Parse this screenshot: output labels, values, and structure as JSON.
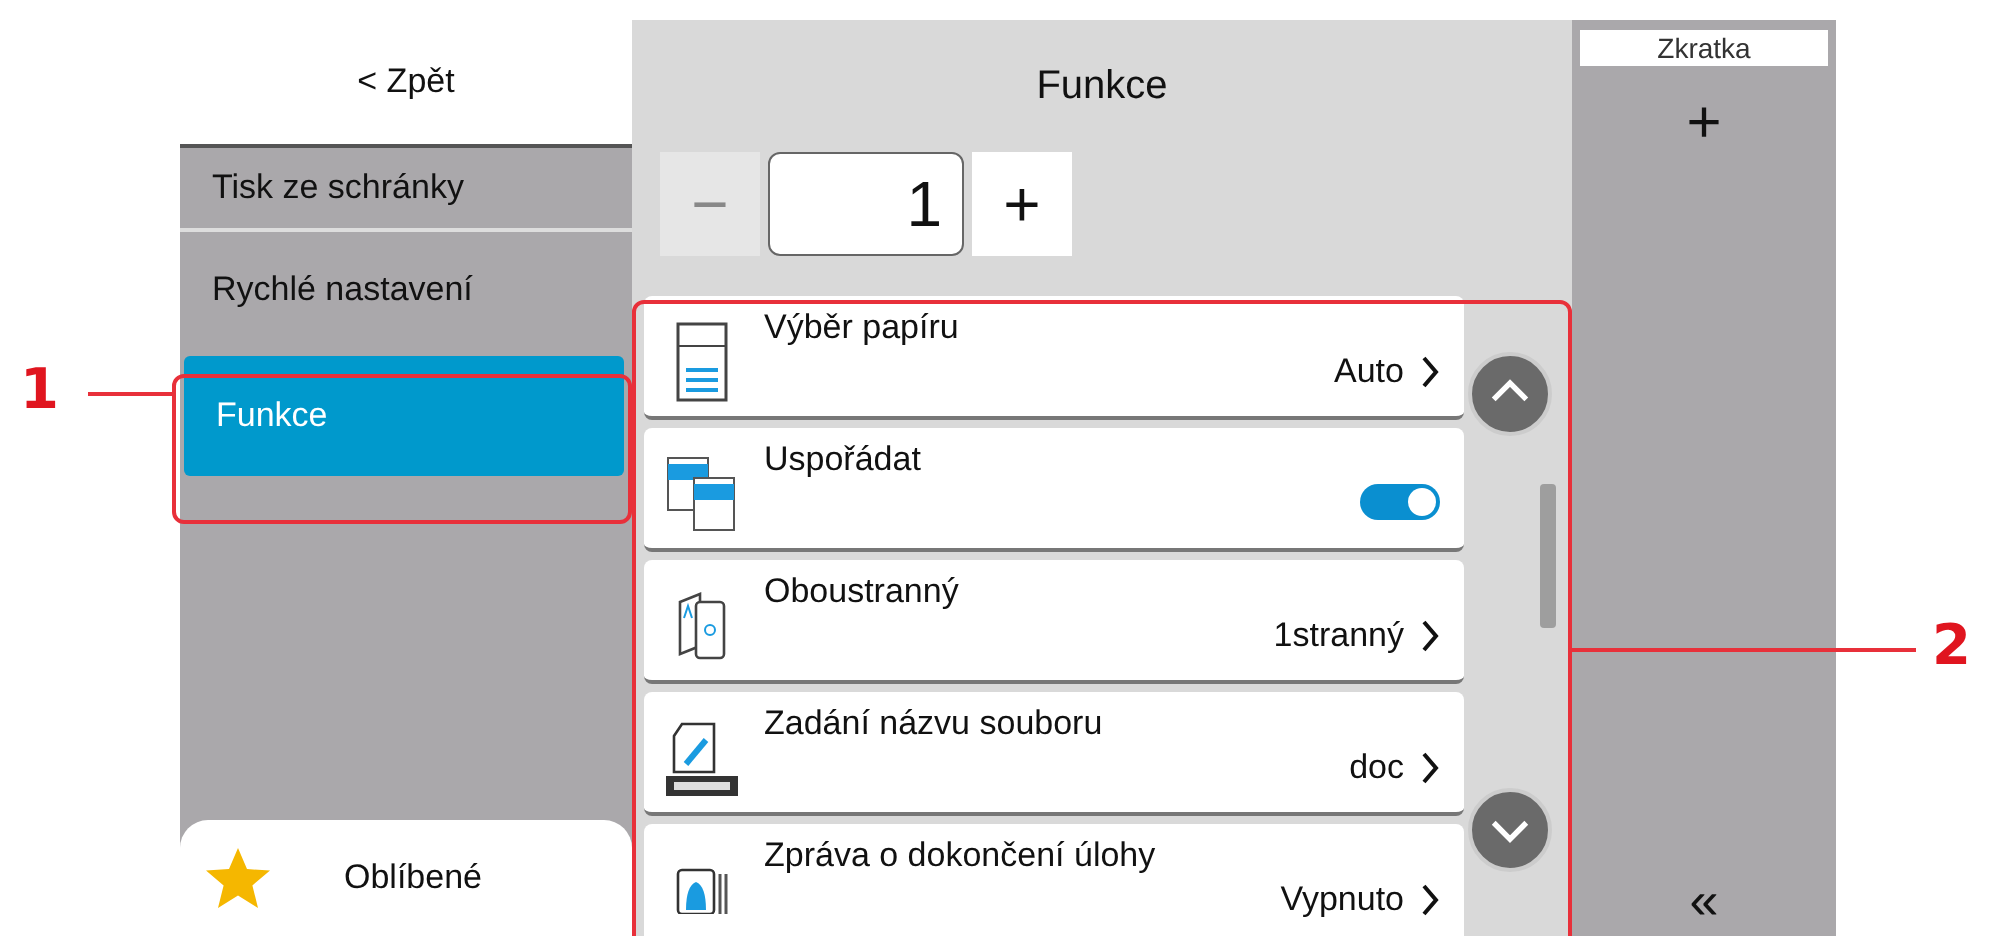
{
  "back_button": {
    "label": "< Zpět"
  },
  "sidebar": {
    "items": [
      {
        "label": "Tisk ze schránky",
        "selected": false
      },
      {
        "label": "Rychlé nastavení",
        "selected": false
      },
      {
        "label": "Funkce",
        "selected": true
      }
    ],
    "favorites": {
      "label": "Oblíbené"
    }
  },
  "panel": {
    "title": "Funkce",
    "copies": {
      "minus": {
        "label": "−",
        "disabled": true
      },
      "value": "1",
      "plus": {
        "label": "+",
        "disabled": false
      }
    },
    "items": [
      {
        "kind": "select",
        "title": "Výběr papíru",
        "value": "Auto"
      },
      {
        "kind": "toggle",
        "title": "Uspořádat",
        "on": true
      },
      {
        "kind": "select",
        "title": "Oboustranný",
        "value": "1stranný"
      },
      {
        "kind": "select",
        "title": "Zadání názvu souboru",
        "value": "doc"
      },
      {
        "kind": "select",
        "title": "Zpráva o dokončení úlohy",
        "value": "Vypnuto"
      }
    ]
  },
  "shortcut": {
    "label": "Zkratka",
    "add": "+",
    "collapse": "«"
  },
  "callouts": [
    {
      "label": "1"
    },
    {
      "label": "2"
    }
  ]
}
